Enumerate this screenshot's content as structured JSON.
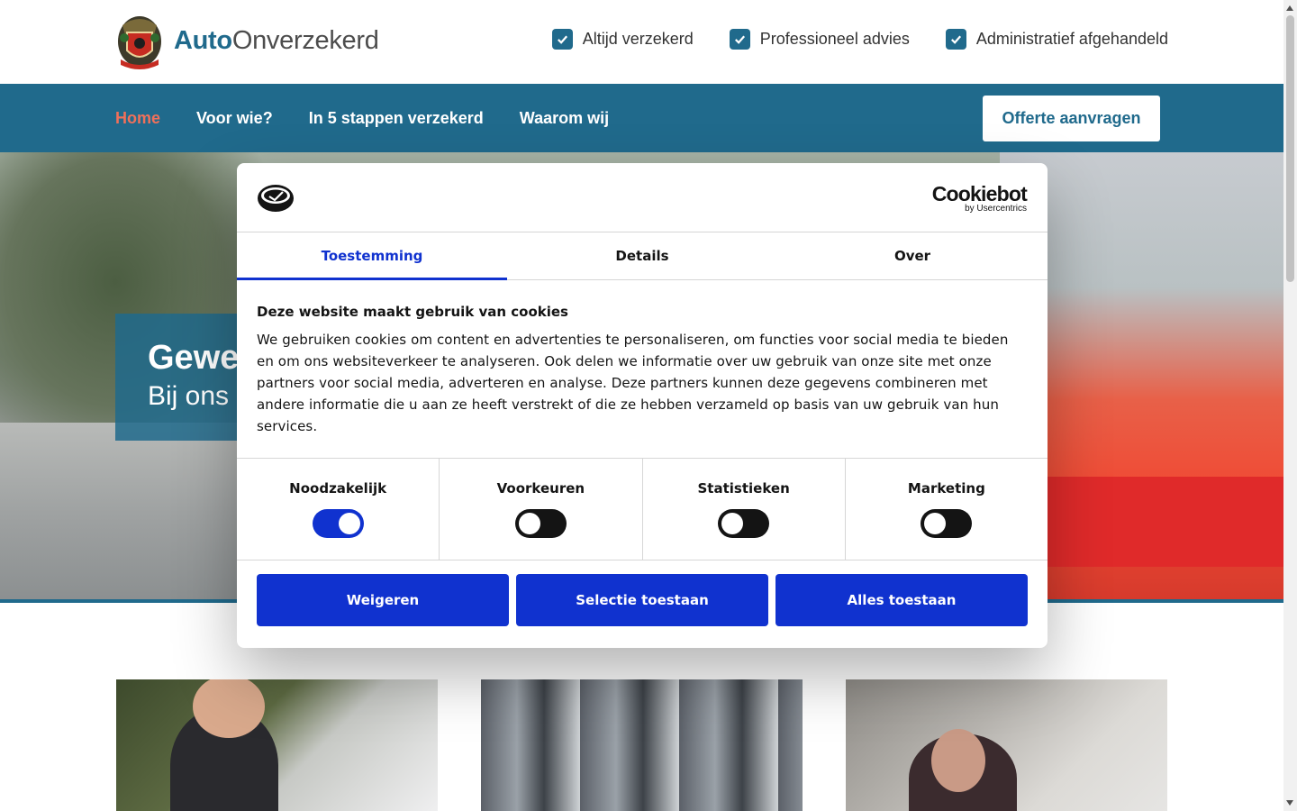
{
  "header": {
    "brand_bold": "Auto",
    "brand_rest": "Onverzekerd",
    "usps": [
      "Altijd verzekerd",
      "Professioneel advies",
      "Administratief afgehandeld"
    ]
  },
  "nav": {
    "items": [
      "Home",
      "Voor wie?",
      "In 5 stappen verzekerd",
      "Waarom wij"
    ],
    "active": "Home",
    "cta": "Offerte aanvragen"
  },
  "hero": {
    "title": "Gewe",
    "subtitle": "Bij ons"
  },
  "cookie_dialog": {
    "brand": "Cookiebot",
    "brand_sub": "by Usercentrics",
    "tabs": [
      "Toestemming",
      "Details",
      "Over"
    ],
    "active_tab": "Toestemming",
    "title": "Deze website maakt gebruik van cookies",
    "text": "We gebruiken cookies om content en advertenties te personaliseren, om functies voor social media te bieden en om ons websiteverkeer te analyseren. Ook delen we informatie over uw gebruik van onze site met onze partners voor social media, adverteren en analyse. Deze partners kunnen deze gegevens combineren met andere informatie die u aan ze heeft verstrekt of die ze hebben verzameld op basis van uw gebruik van hun services.",
    "toggles": [
      {
        "label": "Noodzakelijk",
        "on": true
      },
      {
        "label": "Voorkeuren",
        "on": false
      },
      {
        "label": "Statistieken",
        "on": false
      },
      {
        "label": "Marketing",
        "on": false
      }
    ],
    "buttons": [
      "Weigeren",
      "Selectie toestaan",
      "Alles toestaan"
    ]
  },
  "colors": {
    "brand_blue": "#206a8c",
    "active_nav": "#f0705a",
    "cookie_blue": "#1032cf"
  }
}
